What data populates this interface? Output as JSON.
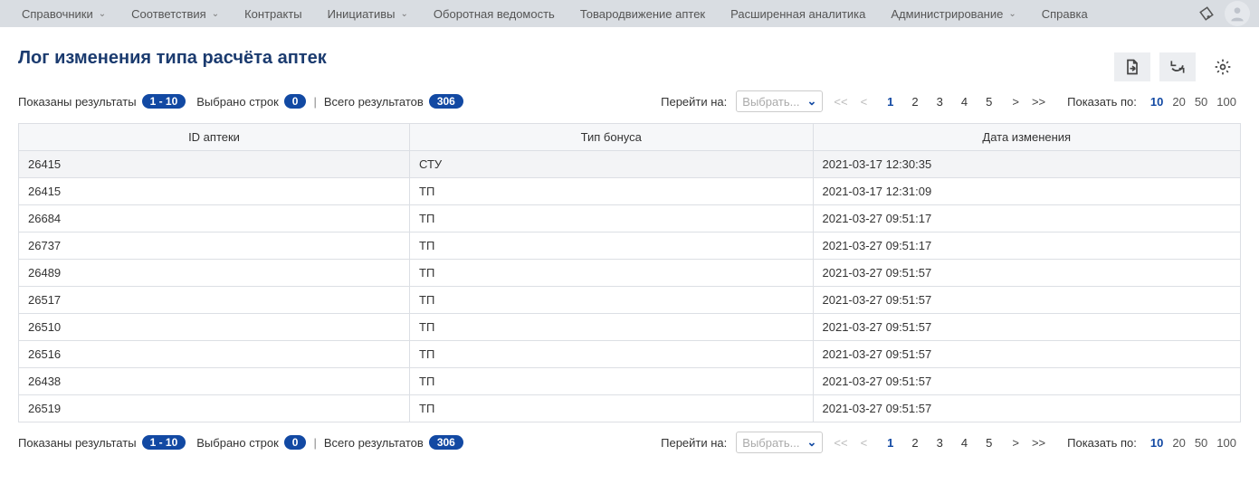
{
  "nav": {
    "items": [
      {
        "label": "Справочники",
        "dropdown": true
      },
      {
        "label": "Соответствия",
        "dropdown": true
      },
      {
        "label": "Контракты",
        "dropdown": false
      },
      {
        "label": "Инициативы",
        "dropdown": true
      },
      {
        "label": "Оборотная ведомость",
        "dropdown": false
      },
      {
        "label": "Товародвижение аптек",
        "dropdown": false
      },
      {
        "label": "Расширенная аналитика",
        "dropdown": false
      },
      {
        "label": "Администрирование",
        "dropdown": true
      },
      {
        "label": "Справка",
        "dropdown": false
      }
    ]
  },
  "page": {
    "title": "Лог изменения типа расчёта аптек"
  },
  "status": {
    "results_label": "Показаны результаты",
    "results_range": "1 - 10",
    "selected_label": "Выбрано строк",
    "selected_count": "0",
    "total_label": "Всего результатов",
    "total_count": "306"
  },
  "pager": {
    "goto_label": "Перейти на:",
    "goto_placeholder": "Выбрать...",
    "pages": [
      "1",
      "2",
      "3",
      "4",
      "5"
    ],
    "active_page": "1",
    "per_page_label": "Показать по:",
    "per_page_options": [
      "10",
      "20",
      "50",
      "100"
    ],
    "per_page_active": "10",
    "first": "<<",
    "prev": "<",
    "next": ">",
    "last": ">>"
  },
  "table": {
    "headers": {
      "id": "ID аптеки",
      "bonus": "Тип бонуса",
      "date": "Дата изменения"
    },
    "rows": [
      {
        "id": "26415",
        "bonus": "СТУ",
        "date": "2021-03-17 12:30:35"
      },
      {
        "id": "26415",
        "bonus": "ТП",
        "date": "2021-03-17 12:31:09"
      },
      {
        "id": "26684",
        "bonus": "ТП",
        "date": "2021-03-27 09:51:17"
      },
      {
        "id": "26737",
        "bonus": "ТП",
        "date": "2021-03-27 09:51:17"
      },
      {
        "id": "26489",
        "bonus": "ТП",
        "date": "2021-03-27 09:51:57"
      },
      {
        "id": "26517",
        "bonus": "ТП",
        "date": "2021-03-27 09:51:57"
      },
      {
        "id": "26510",
        "bonus": "ТП",
        "date": "2021-03-27 09:51:57"
      },
      {
        "id": "26516",
        "bonus": "ТП",
        "date": "2021-03-27 09:51:57"
      },
      {
        "id": "26438",
        "bonus": "ТП",
        "date": "2021-03-27 09:51:57"
      },
      {
        "id": "26519",
        "bonus": "ТП",
        "date": "2021-03-27 09:51:57"
      }
    ]
  }
}
